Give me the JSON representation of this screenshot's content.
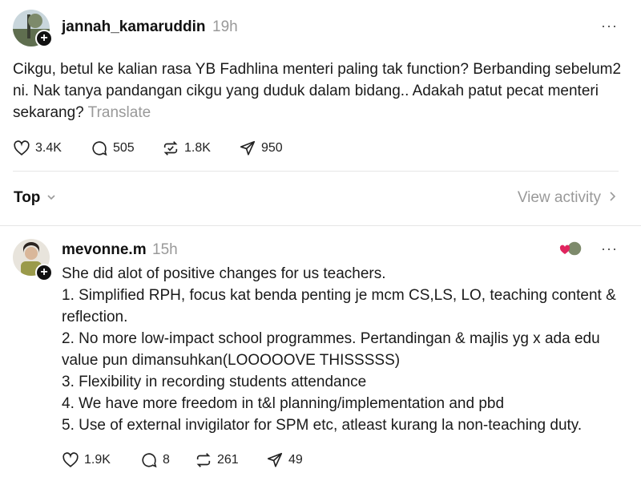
{
  "post": {
    "username": "jannah_kamaruddin",
    "time": "19h",
    "more_label": "···",
    "text": "Cikgu, betul ke kalian rasa YB Fadhlina menteri paling tak function? Berbanding sebelum2 ni. Nak tanya pandangan cikgu yang duduk dalam bidang.. Adakah patut pecat menteri sekarang?",
    "translate_label": "Translate",
    "likes": "3.4K",
    "replies": "505",
    "reposts": "1.8K",
    "shares": "950"
  },
  "sort": {
    "label": "Top",
    "view_activity": "View activity"
  },
  "reply": {
    "username": "mevonne.m",
    "time": "15h",
    "more_label": "···",
    "lines": [
      "She did alot of positive changes for us teachers.",
      "1. Simplified RPH, focus kat benda penting je mcm CS,LS, LO, teaching content & reflection.",
      "2. No more low-impact school programmes. Pertandingan & majlis yg x ada edu value pun dimansuhkan(LOOOOOVE THISSSSS)",
      "3. Flexibility in recording students attendance",
      "4. We have more freedom in t&l planning/implementation and pbd",
      "5. Use of external invigilator for SPM etc, atleast kurang la non-teaching duty."
    ],
    "likes": "1.9K",
    "replies": "8",
    "reposts": "261",
    "shares": "49"
  },
  "icons": {
    "like": "heart-icon",
    "reply": "comment-icon",
    "repost": "repost-icon",
    "share": "send-icon",
    "follow": "plus-icon",
    "liked_by_author": "red-heart-icon"
  },
  "colors": {
    "text": "#101010",
    "muted": "#999999",
    "liked_heart": "#e0245e"
  }
}
